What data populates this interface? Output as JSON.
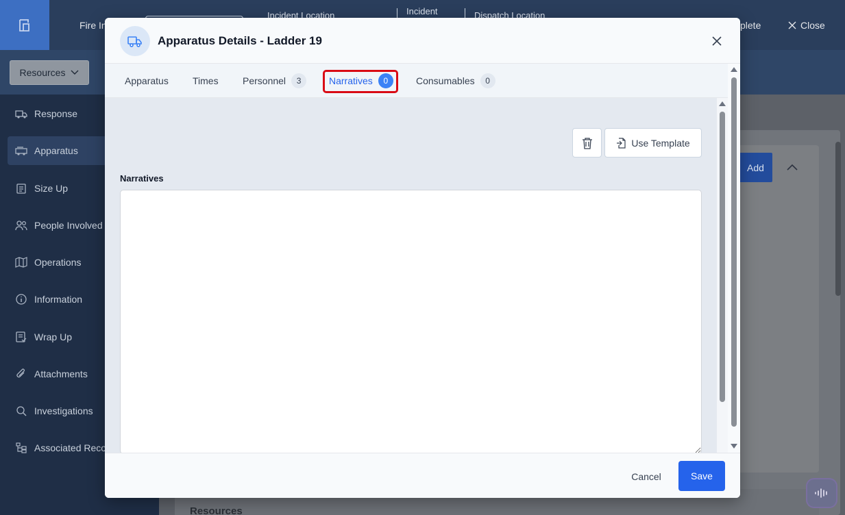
{
  "background": {
    "app_title": "Fire In",
    "top_fields": [
      "Incident Location",
      "Incident",
      "Dispatch Location"
    ],
    "top_actions": {
      "complete": "plete",
      "close": "Close"
    },
    "resources_label": "Resources",
    "sidebar": {
      "items": [
        {
          "label": "Response",
          "icon": "truck-icon"
        },
        {
          "label": "Apparatus",
          "icon": "fire-truck-icon"
        },
        {
          "label": "Size Up",
          "icon": "clipboard-icon"
        },
        {
          "label": "People Involved",
          "icon": "people-icon"
        },
        {
          "label": "Operations",
          "icon": "map-icon"
        },
        {
          "label": "Information",
          "icon": "info-icon"
        },
        {
          "label": "Wrap Up",
          "icon": "checklist-icon"
        },
        {
          "label": "Attachments",
          "icon": "paperclip-icon"
        },
        {
          "label": "Investigations",
          "icon": "search-icon"
        },
        {
          "label": "Associated Recor",
          "icon": "hierarchy-icon"
        }
      ]
    },
    "add_label": "Add",
    "section_title": "Resources"
  },
  "modal": {
    "title": "Apparatus Details - Ladder 19",
    "header_icon": "truck-icon",
    "tabs": [
      {
        "label": "Apparatus"
      },
      {
        "label": "Times"
      },
      {
        "label": "Personnel",
        "badge": "3"
      },
      {
        "label": "Narratives",
        "badge": "0",
        "active": true
      },
      {
        "label": "Consumables",
        "badge": "0"
      }
    ],
    "toolbar": {
      "delete_icon": "trash-icon",
      "template_label": "Use Template",
      "template_icon": "file-import-icon"
    },
    "narratives": {
      "label": "Narratives",
      "value": ""
    },
    "footer": {
      "cancel_label": "Cancel",
      "save_label": "Save"
    }
  },
  "colors": {
    "accent": "#2563eb",
    "highlight": "#d90b14"
  }
}
